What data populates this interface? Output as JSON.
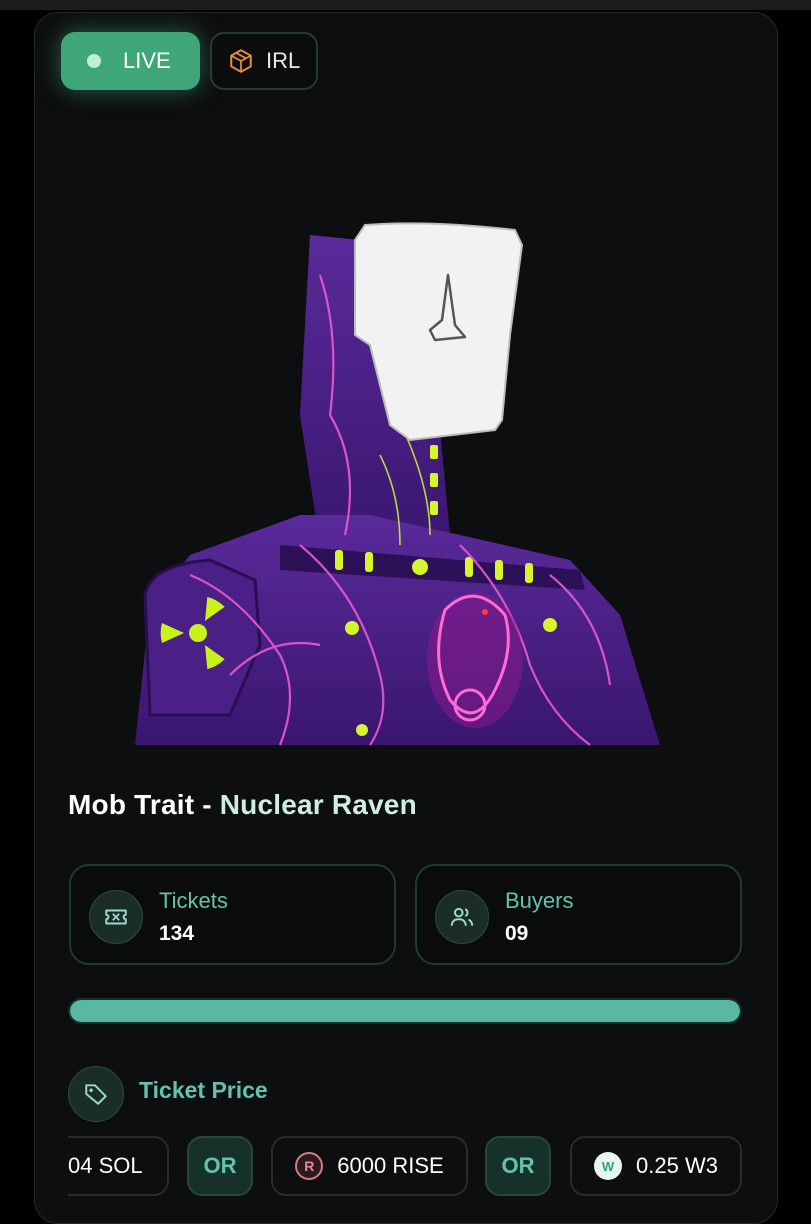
{
  "badges": {
    "live": "LIVE",
    "irl": "IRL"
  },
  "item": {
    "title_prefix": "Mob Trait - ",
    "title_suffix": "Nuclear Raven"
  },
  "stats": {
    "tickets": {
      "label": "Tickets",
      "value": "134"
    },
    "buyers": {
      "label": "Buyers",
      "value": "09"
    }
  },
  "progress": {
    "percent": 100
  },
  "price": {
    "label": "Ticket Price",
    "options": {
      "sol": "04 SOL",
      "or1": "OR",
      "rise": "6000 RISE",
      "or2": "OR",
      "w3": "0.25 W3"
    }
  },
  "colors": {
    "accent": "#3ea678",
    "label_teal": "#62c4ab",
    "progress": "#58b8a4",
    "card_bg": "#0d0e0f"
  },
  "icons": [
    "box-icon",
    "ticket-icon",
    "users-icon",
    "tag-icon",
    "rise-coin-icon",
    "w3-coin-icon"
  ]
}
